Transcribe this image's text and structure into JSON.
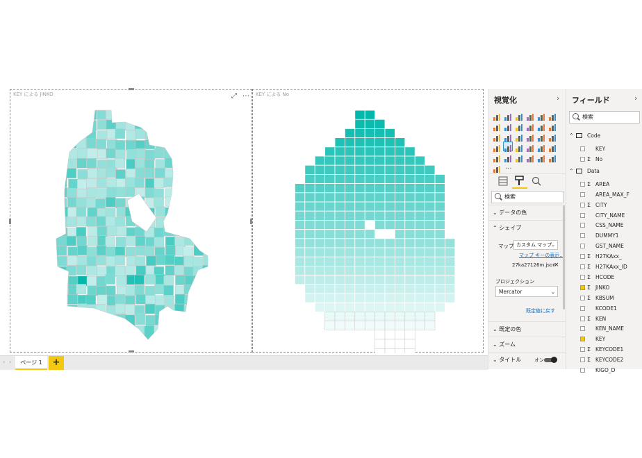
{
  "canvas": {
    "visual1_title": "KEY による JINKO",
    "visual2_title": "KEY による No"
  },
  "tabs": {
    "page1": "ページ 1",
    "add": "+"
  },
  "viz_pane": {
    "title": "視覚化",
    "search_placeholder": "検索",
    "sections": {
      "data_colors": "データの色",
      "shape": "シェイプ",
      "default_colors": "既定の色",
      "zoom": "ズーム",
      "title": "タイトル"
    },
    "shape": {
      "map_label": "マップ",
      "map_value": "カスタム マップ",
      "map_keys_link": "マップ キーの表示...",
      "file_name": "27ka27126m.json",
      "projection_label": "プロジェクション",
      "projection_value": "Mercator",
      "reset_link": "既定値に戻す"
    },
    "title_toggle": "オン",
    "more": "···"
  },
  "fields_pane": {
    "title": "フィールド",
    "search_placeholder": "検索",
    "tables": [
      {
        "name": "Code",
        "fields": [
          {
            "name": "KEY",
            "sigma": false,
            "checked": false
          },
          {
            "name": "No",
            "sigma": true,
            "checked": false
          }
        ]
      },
      {
        "name": "Data",
        "fields": [
          {
            "name": "AREA",
            "sigma": true,
            "checked": false
          },
          {
            "name": "AREA_MAX_F",
            "sigma": false,
            "checked": false
          },
          {
            "name": "CITY",
            "sigma": true,
            "checked": false
          },
          {
            "name": "CITY_NAME",
            "sigma": false,
            "checked": false
          },
          {
            "name": "CSS_NAME",
            "sigma": false,
            "checked": false
          },
          {
            "name": "DUMMY1",
            "sigma": false,
            "checked": false
          },
          {
            "name": "GST_NAME",
            "sigma": false,
            "checked": false
          },
          {
            "name": "H27KAxx_",
            "sigma": true,
            "checked": false
          },
          {
            "name": "H27KAxx_ID",
            "sigma": true,
            "checked": false
          },
          {
            "name": "HCODE",
            "sigma": true,
            "checked": false
          },
          {
            "name": "JINKO",
            "sigma": true,
            "checked": true
          },
          {
            "name": "KBSUM",
            "sigma": true,
            "checked": false
          },
          {
            "name": "KCODE1",
            "sigma": false,
            "checked": false
          },
          {
            "name": "KEN",
            "sigma": true,
            "checked": false
          },
          {
            "name": "KEN_NAME",
            "sigma": false,
            "checked": false
          },
          {
            "name": "KEY",
            "sigma": false,
            "checked": true
          },
          {
            "name": "KEYCODE1",
            "sigma": true,
            "checked": false
          },
          {
            "name": "KEYCODE2",
            "sigma": true,
            "checked": false
          },
          {
            "name": "KIGO_D",
            "sigma": false,
            "checked": false
          }
        ]
      }
    ]
  },
  "colors": {
    "accent": "#f2c811",
    "map_dark": "#01b8aa",
    "map_light": "#e6f7f6"
  }
}
